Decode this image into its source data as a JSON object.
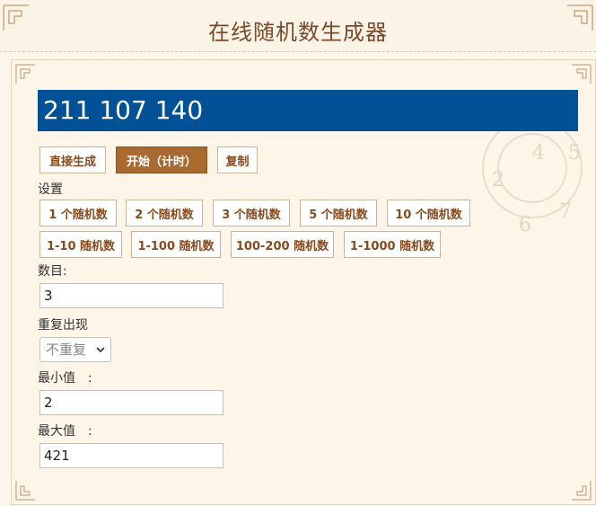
{
  "header": {
    "title": "在线随机数生成器"
  },
  "result": {
    "text": "211 107 140"
  },
  "actions": {
    "generate": "直接生成",
    "start": "开始（计时）",
    "copy": "复制"
  },
  "settings": {
    "label": "设置",
    "count_presets": [
      "1 个随机数",
      "2 个随机数",
      "3 个随机数",
      "5 个随机数",
      "10 个随机数"
    ],
    "range_presets": [
      "1-10 随机数",
      "1-100 随机数",
      "100-200 随机数",
      "1-1000 随机数"
    ]
  },
  "form": {
    "count_label": "数目:",
    "count_value": "3",
    "repeat_label": "重复出现",
    "repeat_value": "不重复",
    "min_label": "最小值　:",
    "min_value": "2",
    "max_label": "最大值　:",
    "max_value": "421"
  },
  "colors": {
    "result_bg": "#005195",
    "accent": "#a86a2f",
    "title": "#7a4a2a"
  }
}
